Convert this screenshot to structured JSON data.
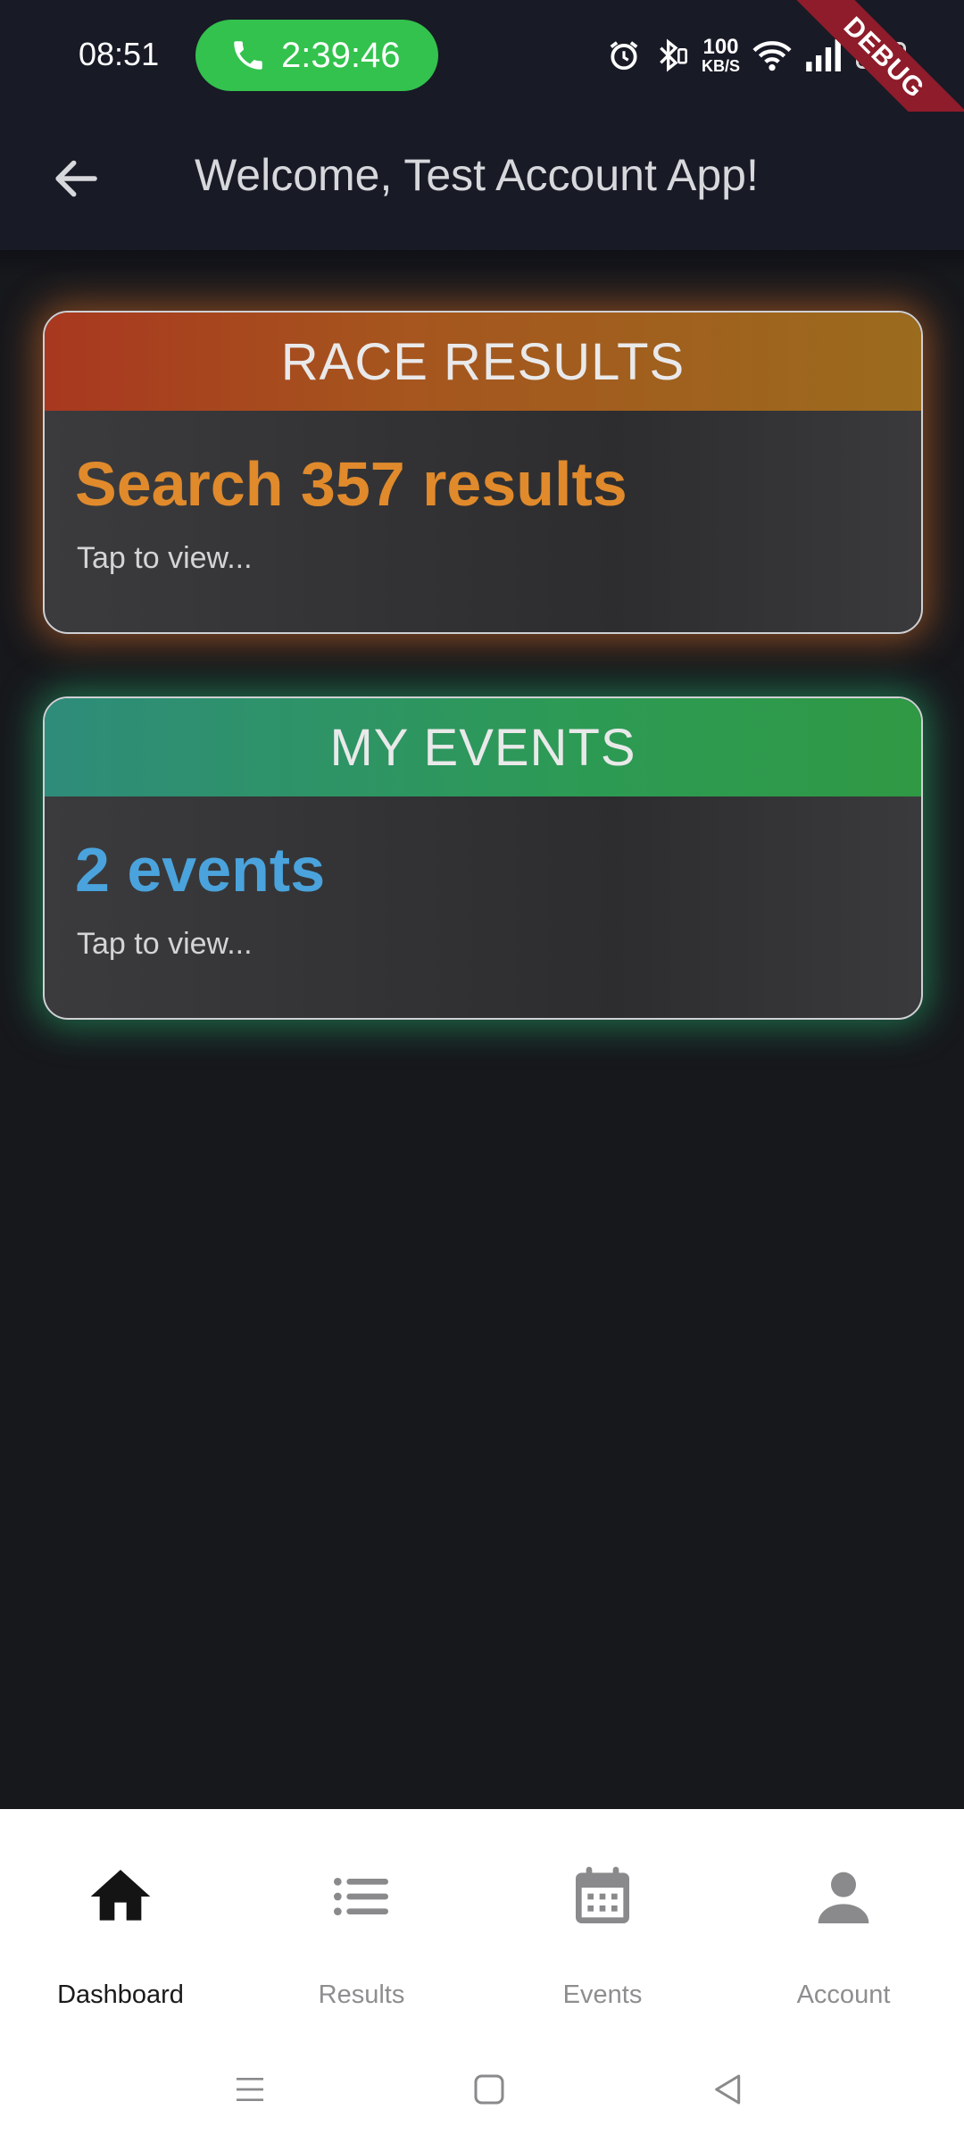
{
  "status_bar": {
    "time": "08:51",
    "call_duration": "2:39:46",
    "net_speed_value": "100",
    "net_speed_unit": "KB/S",
    "battery": "9",
    "debug_banner": "DEBUG",
    "icons": [
      "alarm-icon",
      "bluetooth-icon",
      "wifi-icon",
      "signal-icon",
      "battery-icon"
    ]
  },
  "app_bar": {
    "title": "Welcome, Test Account App!",
    "back_icon": "arrow-back-icon"
  },
  "cards": {
    "race_results": {
      "header": "RACE RESULTS",
      "main": "Search 357 results",
      "sub": "Tap to view..."
    },
    "my_events": {
      "header": "MY EVENTS",
      "main": "2 events",
      "sub": "Tap to view..."
    }
  },
  "bottom_nav": {
    "items": [
      {
        "label": "Dashboard",
        "icon": "home-icon",
        "active": true
      },
      {
        "label": "Results",
        "icon": "list-icon",
        "active": false
      },
      {
        "label": "Events",
        "icon": "calendar-icon",
        "active": false
      },
      {
        "label": "Account",
        "icon": "person-icon",
        "active": false
      }
    ]
  },
  "system_nav": {
    "icons": [
      "menu-icon",
      "home-square-icon",
      "back-triangle-icon"
    ]
  },
  "colors": {
    "background": "#17181c",
    "app_bar": "#181a26",
    "race_accent": "#e08a2c",
    "events_accent": "#4aa3dc",
    "call_pill": "#33c24d",
    "debug_ribbon": "#8e1c2a"
  }
}
